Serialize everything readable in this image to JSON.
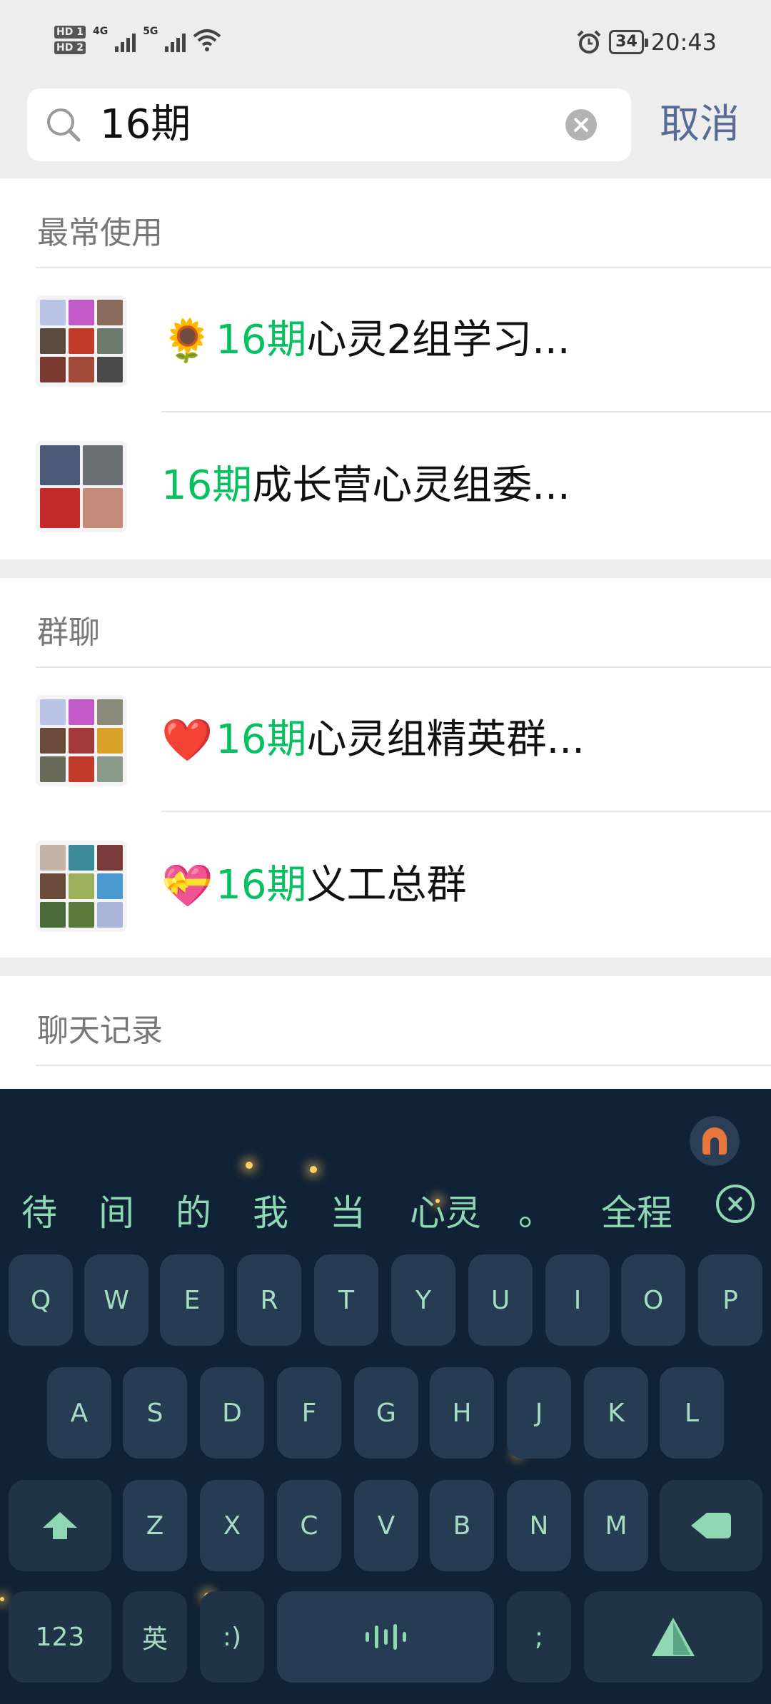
{
  "status_bar": {
    "hd1": "HD 1",
    "hd2": "HD 2",
    "net1": "4G",
    "net2": "5G",
    "battery": "34",
    "time": "20:43"
  },
  "search": {
    "value": "16期",
    "cancel_label": "取消"
  },
  "sections": {
    "frequent": {
      "header": "最常使用",
      "items": [
        {
          "emoji": "🌻",
          "highlight": "16期",
          "rest": "心灵2组学习..."
        },
        {
          "emoji": "",
          "highlight": "16期",
          "rest": "成长营心灵组委..."
        }
      ]
    },
    "groups": {
      "header": "群聊",
      "items": [
        {
          "emoji": "❤️",
          "highlight": "16期",
          "rest": "心灵组精英群..."
        },
        {
          "emoji": "💝",
          "highlight": " 16期",
          "rest": "义工总群"
        }
      ]
    },
    "chat_history": {
      "header": "聊天记录"
    }
  },
  "keyboard": {
    "candidates": [
      "待",
      "间",
      "的",
      "我",
      "当",
      "心灵",
      "。",
      "全程"
    ],
    "row1": [
      "Q",
      "W",
      "E",
      "R",
      "T",
      "Y",
      "U",
      "I",
      "O",
      "P"
    ],
    "row2": [
      "A",
      "S",
      "D",
      "F",
      "G",
      "H",
      "J",
      "K",
      "L"
    ],
    "row3": [
      "Z",
      "X",
      "C",
      "V",
      "B",
      "N",
      "M"
    ],
    "bottom": {
      "numbers": "123",
      "lang": "英",
      "emoticon": ":)",
      "semicolon": ";"
    },
    "colors": {
      "background": "#0f2236",
      "key": "#253c52",
      "key_text": "#a6dcc2"
    }
  },
  "colors": {
    "highlight": "#07c160",
    "cancel": "#576b95"
  }
}
